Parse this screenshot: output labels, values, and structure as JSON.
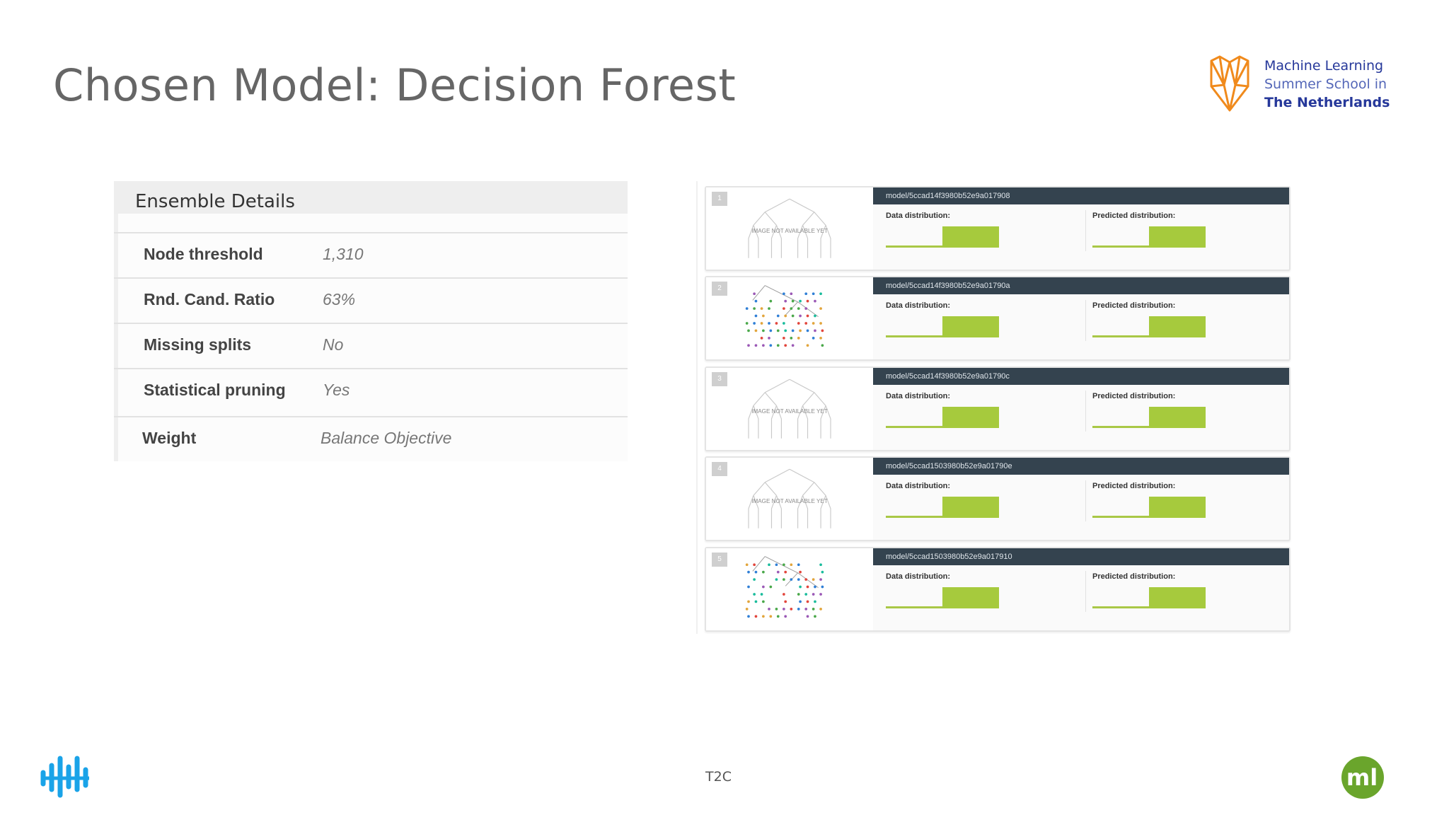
{
  "slide": {
    "title": "Chosen Model: Decision Forest",
    "footer": "T2C"
  },
  "logo": {
    "line1": "Machine Learning",
    "line2": "Summer School in",
    "line3": "The  Netherlands"
  },
  "ensemble": {
    "header": "Ensemble Details",
    "rows": [
      {
        "key": "Node threshold",
        "value": "1,310"
      },
      {
        "key": "Rnd. Cand. Ratio",
        "value": "63%"
      },
      {
        "key": "Missing splits",
        "value": "No"
      },
      {
        "key": "Statistical pruning",
        "value": "Yes"
      },
      {
        "key": "Weight",
        "value": "Balance Objective"
      }
    ]
  },
  "models": {
    "data_label": "Data distribution:",
    "pred_label": "Predicted distribution:",
    "placeholder_text": "IMAGE NOT AVAILABLE YET",
    "items": [
      {
        "num": "1",
        "id": "model/5ccad14f3980b52e9a017908",
        "tree": "placeholder"
      },
      {
        "num": "2",
        "id": "model/5ccad14f3980b52e9a01790a",
        "tree": "colored"
      },
      {
        "num": "3",
        "id": "model/5ccad14f3980b52e9a01790c",
        "tree": "placeholder"
      },
      {
        "num": "4",
        "id": "model/5ccad1503980b52e9a01790e",
        "tree": "placeholder"
      },
      {
        "num": "5",
        "id": "model/5ccad1503980b52e9a017910",
        "tree": "colored"
      }
    ]
  },
  "colors": {
    "model_header_bg": "#34434f",
    "bar_green": "#a6ca3d",
    "logo_orange": "#f08a1c",
    "logo_blue": "#26389a",
    "waves_blue": "#1aa3e8",
    "ml_green": "#6aa52c"
  }
}
